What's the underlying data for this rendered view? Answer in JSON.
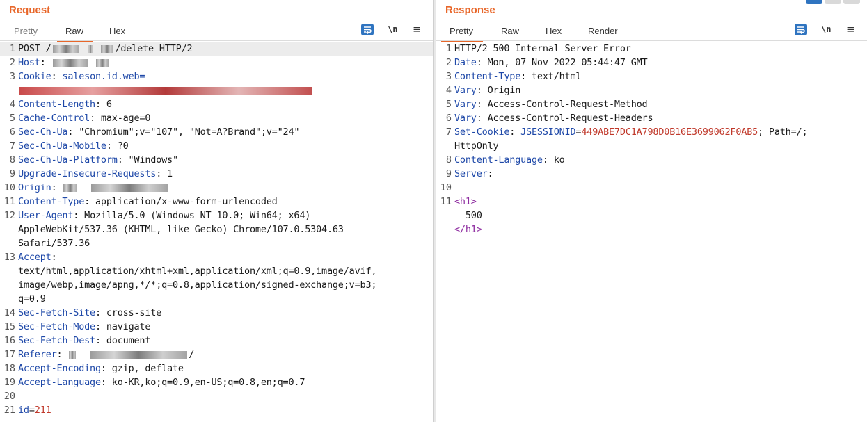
{
  "request": {
    "title": "Request",
    "tabs": [
      "Pretty",
      "Raw",
      "Hex"
    ],
    "active_tab": "Raw",
    "tools": {
      "newline_label": "\\n",
      "menu_label": "≡"
    },
    "lines": [
      {
        "n": "1",
        "parts": [
          {
            "t": "POST /"
          },
          {
            "redact": 38
          },
          {
            "t": " "
          },
          {
            "redact": 8
          },
          {
            "t": " "
          },
          {
            "redact": 18
          },
          {
            "t": "/delete HTTP/2"
          }
        ],
        "hl": true
      },
      {
        "n": "2",
        "parts": [
          {
            "t": "Host",
            "c": "k"
          },
          {
            "t": ": "
          },
          {
            "redact": 50
          },
          {
            "t": " "
          },
          {
            "redact": 18
          }
        ]
      },
      {
        "n": "3",
        "parts": [
          {
            "t": "Cookie",
            "c": "k"
          },
          {
            "t": ": "
          },
          {
            "t": "saleson.id.web=",
            "c": "k"
          }
        ]
      },
      {
        "n": "",
        "parts": [
          {
            "redact_red": 420
          }
        ]
      },
      {
        "n": "4",
        "parts": [
          {
            "t": "Content-Length",
            "c": "k"
          },
          {
            "t": ": 6"
          }
        ]
      },
      {
        "n": "5",
        "parts": [
          {
            "t": "Cache-Control",
            "c": "k"
          },
          {
            "t": ": max-age=0"
          }
        ]
      },
      {
        "n": "6",
        "parts": [
          {
            "t": "Sec-Ch-Ua",
            "c": "k"
          },
          {
            "t": ": \"Chromium\";v=\"107\", \"Not=A?Brand\";v=\"24\""
          }
        ]
      },
      {
        "n": "7",
        "parts": [
          {
            "t": "Sec-Ch-Ua-Mobile",
            "c": "k"
          },
          {
            "t": ": ?0"
          }
        ]
      },
      {
        "n": "8",
        "parts": [
          {
            "t": "Sec-Ch-Ua-Platform",
            "c": "k"
          },
          {
            "t": ": \"Windows\""
          }
        ]
      },
      {
        "n": "9",
        "parts": [
          {
            "t": "Upgrade-Insecure-Requests",
            "c": "k"
          },
          {
            "t": ": 1"
          }
        ]
      },
      {
        "n": "10",
        "parts": [
          {
            "t": "Origin",
            "c": "k"
          },
          {
            "t": ": "
          },
          {
            "redact": 20
          },
          {
            "t": "  "
          },
          {
            "redact": 110
          }
        ]
      },
      {
        "n": "11",
        "parts": [
          {
            "t": "Content-Type",
            "c": "k"
          },
          {
            "t": ": application/x-www-form-urlencoded"
          }
        ]
      },
      {
        "n": "12",
        "parts": [
          {
            "t": "User-Agent",
            "c": "k"
          },
          {
            "t": ": Mozilla/5.0 (Windows NT 10.0; Win64; x64)"
          }
        ]
      },
      {
        "n": "",
        "parts": [
          {
            "t": "AppleWebKit/537.36 (KHTML, like Gecko) Chrome/107.0.5304.63"
          }
        ]
      },
      {
        "n": "",
        "parts": [
          {
            "t": "Safari/537.36"
          }
        ]
      },
      {
        "n": "13",
        "parts": [
          {
            "t": "Accept",
            "c": "k"
          },
          {
            "t": ":"
          }
        ]
      },
      {
        "n": "",
        "parts": [
          {
            "t": "text/html,application/xhtml+xml,application/xml;q=0.9,image/avif,"
          }
        ]
      },
      {
        "n": "",
        "parts": [
          {
            "t": "image/webp,image/apng,*/*;q=0.8,application/signed-exchange;v=b3;"
          }
        ]
      },
      {
        "n": "",
        "parts": [
          {
            "t": "q=0.9"
          }
        ]
      },
      {
        "n": "14",
        "parts": [
          {
            "t": "Sec-Fetch-Site",
            "c": "k"
          },
          {
            "t": ": cross-site"
          }
        ]
      },
      {
        "n": "15",
        "parts": [
          {
            "t": "Sec-Fetch-Mode",
            "c": "k"
          },
          {
            "t": ": navigate"
          }
        ]
      },
      {
        "n": "16",
        "parts": [
          {
            "t": "Sec-Fetch-Dest",
            "c": "k"
          },
          {
            "t": ": document"
          }
        ]
      },
      {
        "n": "17",
        "parts": [
          {
            "t": "Referer",
            "c": "k"
          },
          {
            "t": ": "
          },
          {
            "redact": 10
          },
          {
            "t": "  "
          },
          {
            "redact": 140
          },
          {
            "t": "/"
          }
        ]
      },
      {
        "n": "18",
        "parts": [
          {
            "t": "Accept-Encoding",
            "c": "k"
          },
          {
            "t": ": gzip, deflate"
          }
        ]
      },
      {
        "n": "19",
        "parts": [
          {
            "t": "Accept-Language",
            "c": "k"
          },
          {
            "t": ": ko-KR,ko;q=0.9,en-US;q=0.8,en;q=0.7"
          }
        ]
      },
      {
        "n": "20",
        "parts": [
          {
            "t": ""
          }
        ]
      },
      {
        "n": "21",
        "parts": [
          {
            "t": "id",
            "c": "k"
          },
          {
            "t": "="
          },
          {
            "t": "211",
            "c": "v"
          }
        ]
      }
    ]
  },
  "response": {
    "title": "Response",
    "tabs": [
      "Pretty",
      "Raw",
      "Hex",
      "Render"
    ],
    "active_tab": "Pretty",
    "tools": {
      "newline_label": "\\n",
      "menu_label": "≡"
    },
    "lines": [
      {
        "n": "1",
        "parts": [
          {
            "t": "HTTP/2 500 Internal Server Error"
          }
        ]
      },
      {
        "n": "2",
        "parts": [
          {
            "t": "Date",
            "c": "k"
          },
          {
            "t": ": Mon, 07 Nov 2022 05:44:47 GMT"
          }
        ]
      },
      {
        "n": "3",
        "parts": [
          {
            "t": "Content-Type",
            "c": "k"
          },
          {
            "t": ": text/html"
          }
        ]
      },
      {
        "n": "4",
        "parts": [
          {
            "t": "Vary",
            "c": "k"
          },
          {
            "t": ": Origin"
          }
        ]
      },
      {
        "n": "5",
        "parts": [
          {
            "t": "Vary",
            "c": "k"
          },
          {
            "t": ": Access-Control-Request-Method"
          }
        ]
      },
      {
        "n": "6",
        "parts": [
          {
            "t": "Vary",
            "c": "k"
          },
          {
            "t": ": Access-Control-Request-Headers"
          }
        ]
      },
      {
        "n": "7",
        "parts": [
          {
            "t": "Set-Cookie",
            "c": "k"
          },
          {
            "t": ": "
          },
          {
            "t": "JSESSIONID",
            "c": "k"
          },
          {
            "t": "="
          },
          {
            "t": "449ABE7DC1A798D0B16E3699062F0AB5",
            "c": "v"
          },
          {
            "t": "; Path=/;"
          }
        ]
      },
      {
        "n": "",
        "parts": [
          {
            "t": "HttpOnly"
          }
        ]
      },
      {
        "n": "8",
        "parts": [
          {
            "t": "Content-Language",
            "c": "k"
          },
          {
            "t": ": ko"
          }
        ]
      },
      {
        "n": "9",
        "parts": [
          {
            "t": "Server",
            "c": "k"
          },
          {
            "t": ":"
          }
        ]
      },
      {
        "n": "10",
        "parts": [
          {
            "t": ""
          }
        ]
      },
      {
        "n": "11",
        "parts": [
          {
            "t": "<h1>",
            "c": "tag"
          }
        ]
      },
      {
        "n": "",
        "parts": [
          {
            "t": "  500"
          }
        ]
      },
      {
        "n": "",
        "parts": [
          {
            "t": "</h1>",
            "c": "tag"
          }
        ]
      }
    ]
  },
  "colors": {
    "accent": "#e8672a",
    "key": "#1e48a8",
    "value": "#c0392b",
    "tag": "#8e2ca0",
    "wrap_button": "#2f74c0"
  },
  "icons": {
    "wrap": "wrap-lines-icon",
    "newline": "newline-toggle-icon",
    "menu": "hamburger-menu-icon"
  }
}
